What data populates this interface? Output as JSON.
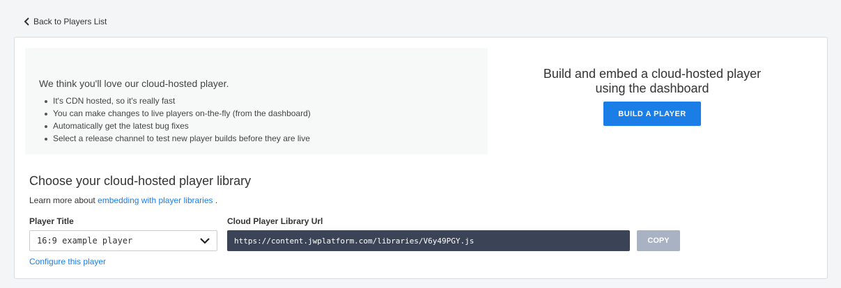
{
  "nav": {
    "back_label": "Back to Players List",
    "back_icon": "chevron-left-icon"
  },
  "promo": {
    "intro": "We think you'll love our cloud-hosted player.",
    "bullets": [
      "It's CDN hosted, so it's really fast",
      "You can make changes to live players on-the-fly (from the dashboard)",
      "Automatically get the latest bug fixes",
      "Select a release channel to test new player builds before they are live"
    ]
  },
  "build": {
    "heading_line1": "Build and embed a cloud-hosted player",
    "heading_line2": "using the dashboard",
    "button_label": "BUILD A PLAYER"
  },
  "library": {
    "title": "Choose your cloud-hosted player library",
    "learn_prefix": "Learn more about",
    "learn_link": "embedding with player libraries",
    "learn_suffix": ".",
    "player_title_label": "Player Title",
    "player_title_value": "16:9 example player",
    "url_label": "Cloud Player Library Url",
    "url_value": "https://content.jwplatform.com/libraries/V6y49PGY.js",
    "copy_label": "COPY",
    "configure_label": "Configure this player"
  },
  "colors": {
    "accent": "#1b7ee6",
    "url_bg": "#3b4456",
    "copy_disabled": "#a9b2c2",
    "promo_bg": "#f7f8f8"
  }
}
